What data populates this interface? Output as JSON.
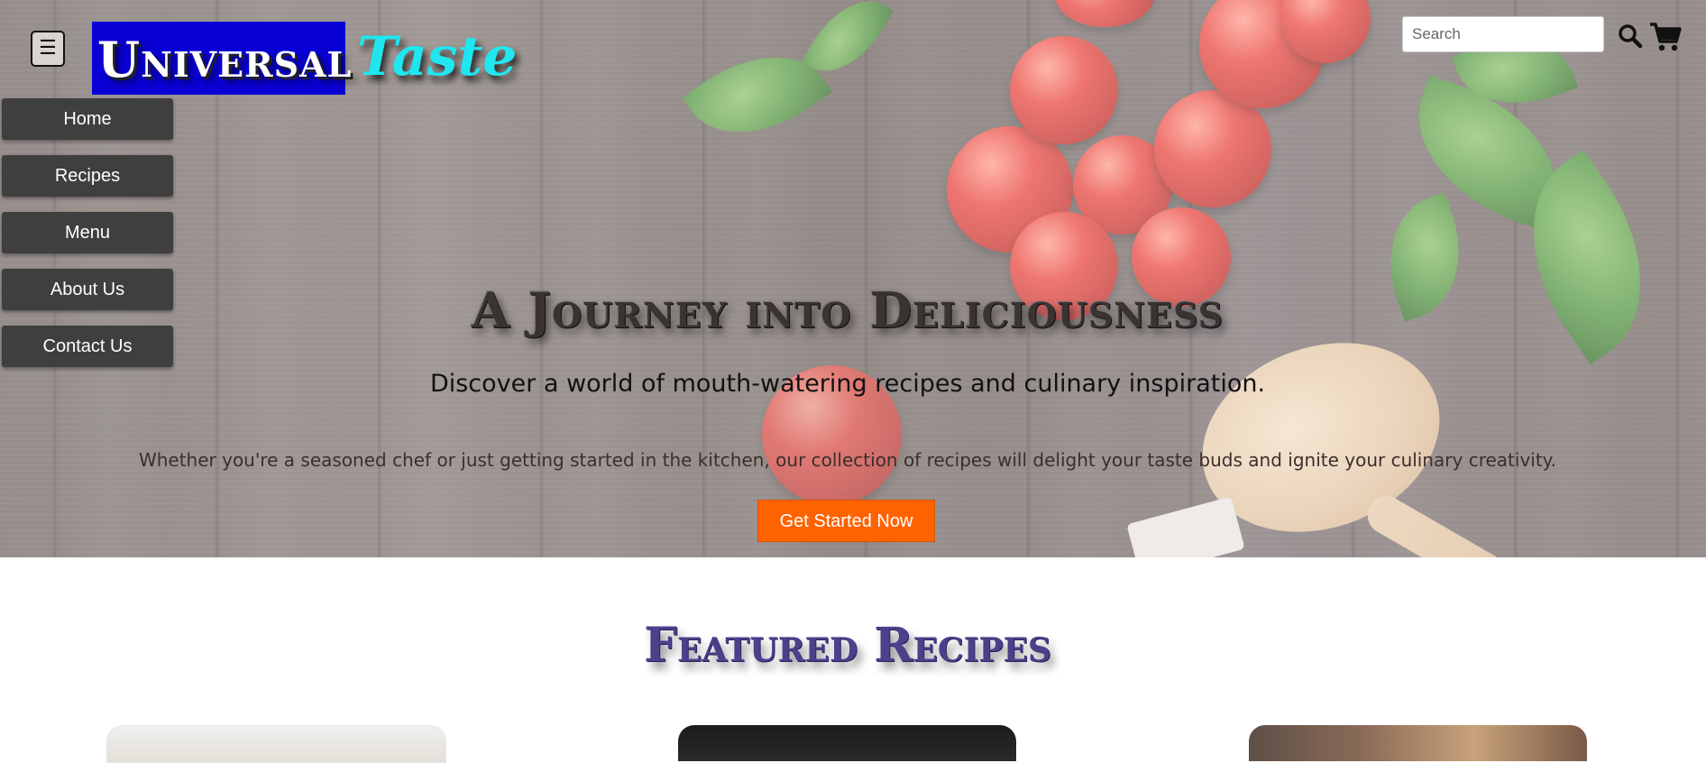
{
  "header": {
    "menu_toggle_label": "☰",
    "logo_universal": "Universal",
    "logo_taste": "Taste",
    "search": {
      "placeholder": "Search",
      "value": ""
    },
    "icons": [
      "search-icon",
      "cart-icon",
      "menu-icon"
    ]
  },
  "nav": {
    "items": [
      {
        "label": "Home"
      },
      {
        "label": "Recipes"
      },
      {
        "label": "Menu"
      },
      {
        "label": "About Us"
      },
      {
        "label": "Contact Us"
      }
    ]
  },
  "hero": {
    "title": "A Journey into Deliciousness",
    "subtitle": "Discover a world of mouth-watering recipes and culinary inspiration.",
    "body": "Whether you're a seasoned chef or just getting started in the kitchen, our collection of recipes will delight your taste buds and ignite your culinary creativity.",
    "cta_label": "Get Started Now"
  },
  "featured": {
    "title": "Featured Recipes"
  },
  "colors": {
    "logo_box": "#0a00d6",
    "logo_taste": "#20e6f0",
    "nav_bg": "#3f3f3f",
    "cta_bg": "#ff6300",
    "featured_title": "#4d3f8a"
  }
}
